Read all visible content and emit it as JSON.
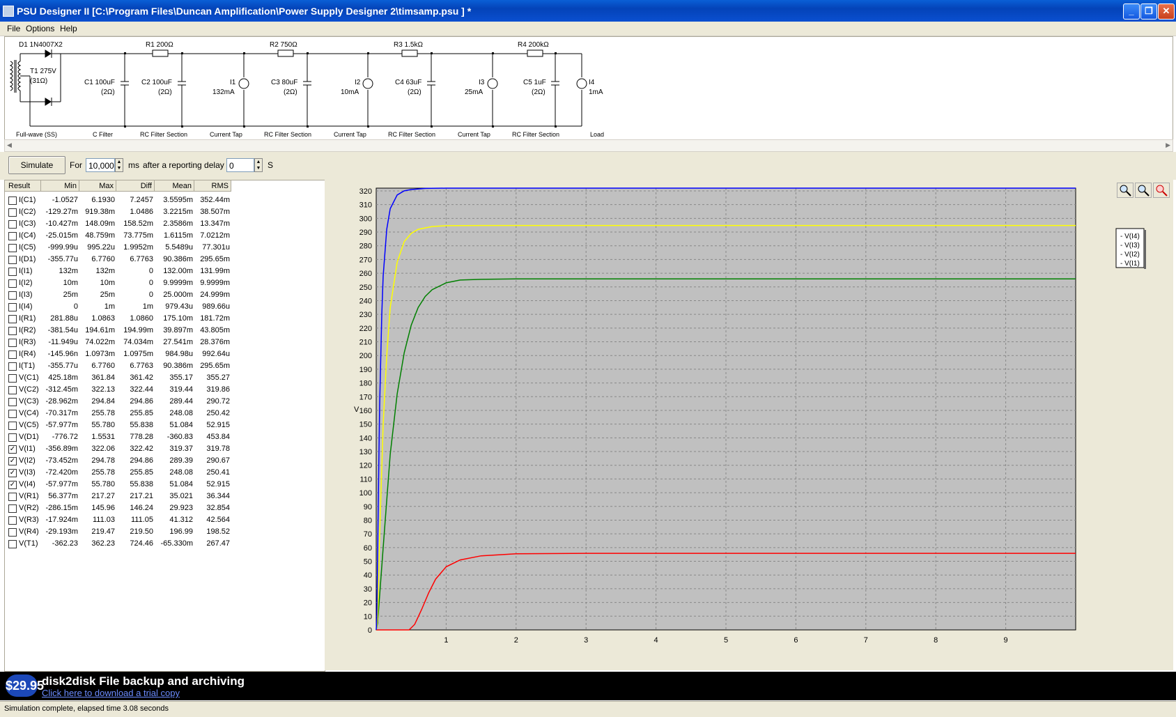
{
  "window": {
    "title": "PSU Designer II  [C:\\Program Files\\Duncan Amplification\\Power Supply Designer  2\\timsamp.psu ] *",
    "minimize": "_",
    "restore": "❐",
    "close": "✕"
  },
  "menu": {
    "file": "File",
    "options": "Options",
    "help": "Help"
  },
  "schematic": {
    "d1": "D1 1N4007X2",
    "t1_line1": "T1 275V",
    "t1_line2": "(31Ω)",
    "r1": "R1 200Ω",
    "r2": "R2 750Ω",
    "r3": "R3 1.5kΩ",
    "r4": "R4 200kΩ",
    "c1_line1": "C1 100uF",
    "c1_line2": "(2Ω)",
    "c2_line1": "C2 100uF",
    "c2_line2": "(2Ω)",
    "i1_line1": "I1",
    "i1_line2": "132mA",
    "c3_line1": "C3 80uF",
    "c3_line2": "(2Ω)",
    "i2_line1": "I2",
    "i2_line2": "10mA",
    "c4_line1": "C4 63uF",
    "c4_line2": "(2Ω)",
    "i3_line1": "I3",
    "i3_line2": "25mA",
    "c5_line1": "C5 1uF",
    "c5_line2": "(2Ω)",
    "i4_line1": "I4",
    "i4_line2": "1mA",
    "sections": [
      "Full-wave (SS)",
      "C Filter",
      "RC Filter Section",
      "Current Tap",
      "RC Filter Section",
      "Current Tap",
      "RC Filter Section",
      "Current Tap",
      "RC Filter Section",
      "Load"
    ]
  },
  "toolbar": {
    "simulate": "Simulate",
    "for": "For",
    "duration": "10,000",
    "ms": "ms",
    "delay_label": "after a reporting delay of",
    "delay": "0",
    "s": "S"
  },
  "table": {
    "headers": [
      "Result",
      "Min",
      "Max",
      "Diff",
      "Mean",
      "RMS"
    ],
    "rows": [
      {
        "checked": false,
        "name": "I(C1)",
        "min": "-1.0527",
        "max": "6.1930",
        "diff": "7.2457",
        "mean": "3.5595m",
        "rms": "352.44m"
      },
      {
        "checked": false,
        "name": "I(C2)",
        "min": "-129.27m",
        "max": "919.38m",
        "diff": "1.0486",
        "mean": "3.2215m",
        "rms": "38.507m"
      },
      {
        "checked": false,
        "name": "I(C3)",
        "min": "-10.427m",
        "max": "148.09m",
        "diff": "158.52m",
        "mean": "2.3586m",
        "rms": "13.347m"
      },
      {
        "checked": false,
        "name": "I(C4)",
        "min": "-25.015m",
        "max": "48.759m",
        "diff": "73.775m",
        "mean": "1.6115m",
        "rms": "7.0212m"
      },
      {
        "checked": false,
        "name": "I(C5)",
        "min": "-999.99u",
        "max": "995.22u",
        "diff": "1.9952m",
        "mean": "5.5489u",
        "rms": "77.301u"
      },
      {
        "checked": false,
        "name": "I(D1)",
        "min": "-355.77u",
        "max": "6.7760",
        "diff": "6.7763",
        "mean": "90.386m",
        "rms": "295.65m"
      },
      {
        "checked": false,
        "name": "I(I1)",
        "min": "132m",
        "max": "132m",
        "diff": "0",
        "mean": "132.00m",
        "rms": "131.99m"
      },
      {
        "checked": false,
        "name": "I(I2)",
        "min": "10m",
        "max": "10m",
        "diff": "0",
        "mean": "9.9999m",
        "rms": "9.9999m"
      },
      {
        "checked": false,
        "name": "I(I3)",
        "min": "25m",
        "max": "25m",
        "diff": "0",
        "mean": "25.000m",
        "rms": "24.999m"
      },
      {
        "checked": false,
        "name": "I(I4)",
        "min": "0",
        "max": "1m",
        "diff": "1m",
        "mean": "979.43u",
        "rms": "989.66u"
      },
      {
        "checked": false,
        "name": "I(R1)",
        "min": "281.88u",
        "max": "1.0863",
        "diff": "1.0860",
        "mean": "175.10m",
        "rms": "181.72m"
      },
      {
        "checked": false,
        "name": "I(R2)",
        "min": "-381.54u",
        "max": "194.61m",
        "diff": "194.99m",
        "mean": "39.897m",
        "rms": "43.805m"
      },
      {
        "checked": false,
        "name": "I(R3)",
        "min": "-11.949u",
        "max": "74.022m",
        "diff": "74.034m",
        "mean": "27.541m",
        "rms": "28.376m"
      },
      {
        "checked": false,
        "name": "I(R4)",
        "min": "-145.96n",
        "max": "1.0973m",
        "diff": "1.0975m",
        "mean": "984.98u",
        "rms": "992.64u"
      },
      {
        "checked": false,
        "name": "I(T1)",
        "min": "-355.77u",
        "max": "6.7760",
        "diff": "6.7763",
        "mean": "90.386m",
        "rms": "295.65m"
      },
      {
        "checked": false,
        "name": "V(C1)",
        "min": "425.18m",
        "max": "361.84",
        "diff": "361.42",
        "mean": "355.17",
        "rms": "355.27"
      },
      {
        "checked": false,
        "name": "V(C2)",
        "min": "-312.45m",
        "max": "322.13",
        "diff": "322.44",
        "mean": "319.44",
        "rms": "319.86"
      },
      {
        "checked": false,
        "name": "V(C3)",
        "min": "-28.962m",
        "max": "294.84",
        "diff": "294.86",
        "mean": "289.44",
        "rms": "290.72"
      },
      {
        "checked": false,
        "name": "V(C4)",
        "min": "-70.317m",
        "max": "255.78",
        "diff": "255.85",
        "mean": "248.08",
        "rms": "250.42"
      },
      {
        "checked": false,
        "name": "V(C5)",
        "min": "-57.977m",
        "max": "55.780",
        "diff": "55.838",
        "mean": "51.084",
        "rms": "52.915"
      },
      {
        "checked": false,
        "name": "V(D1)",
        "min": "-776.72",
        "max": "1.5531",
        "diff": "778.28",
        "mean": "-360.83",
        "rms": "453.84"
      },
      {
        "checked": true,
        "name": "V(I1)",
        "min": "-356.89m",
        "max": "322.06",
        "diff": "322.42",
        "mean": "319.37",
        "rms": "319.78"
      },
      {
        "checked": true,
        "name": "V(I2)",
        "min": "-73.452m",
        "max": "294.78",
        "diff": "294.86",
        "mean": "289.39",
        "rms": "290.67"
      },
      {
        "checked": true,
        "name": "V(I3)",
        "min": "-72.420m",
        "max": "255.78",
        "diff": "255.85",
        "mean": "248.08",
        "rms": "250.41"
      },
      {
        "checked": true,
        "name": "V(I4)",
        "min": "-57.977m",
        "max": "55.780",
        "diff": "55.838",
        "mean": "51.084",
        "rms": "52.915"
      },
      {
        "checked": false,
        "name": "V(R1)",
        "min": "56.377m",
        "max": "217.27",
        "diff": "217.21",
        "mean": "35.021",
        "rms": "36.344"
      },
      {
        "checked": false,
        "name": "V(R2)",
        "min": "-286.15m",
        "max": "145.96",
        "diff": "146.24",
        "mean": "29.923",
        "rms": "32.854"
      },
      {
        "checked": false,
        "name": "V(R3)",
        "min": "-17.924m",
        "max": "111.03",
        "diff": "111.05",
        "mean": "41.312",
        "rms": "42.564"
      },
      {
        "checked": false,
        "name": "V(R4)",
        "min": "-29.193m",
        "max": "219.47",
        "diff": "219.50",
        "mean": "196.99",
        "rms": "198.52"
      },
      {
        "checked": false,
        "name": "V(T1)",
        "min": "-362.23",
        "max": "362.23",
        "diff": "724.46",
        "mean": "-65.330m",
        "rms": "267.47"
      }
    ]
  },
  "chart_data": {
    "type": "line",
    "ylabel": "V",
    "xlabel": "",
    "xlim": [
      0,
      10
    ],
    "ylim": [
      0,
      322
    ],
    "xticks": [
      "1",
      "2",
      "3",
      "4",
      "5",
      "6",
      "7",
      "8",
      "9"
    ],
    "yticks": [
      "0",
      "10",
      "20",
      "30",
      "40",
      "50",
      "60",
      "70",
      "80",
      "90",
      "100",
      "110",
      "120",
      "130",
      "140",
      "150",
      "160",
      "170",
      "180",
      "190",
      "200",
      "210",
      "220",
      "230",
      "240",
      "250",
      "260",
      "270",
      "280",
      "290",
      "300",
      "310",
      "320"
    ],
    "grid": true,
    "legend_position": "right",
    "background": "#c0c0c0",
    "series": [
      {
        "name": "V(I4)",
        "color": "#ff0000",
        "x": [
          0,
          0.4,
          0.47,
          0.55,
          0.65,
          0.75,
          0.85,
          1.0,
          1.2,
          1.5,
          2,
          3,
          5,
          10
        ],
        "y": [
          0,
          0,
          0,
          4,
          15,
          27,
          37,
          46,
          51,
          54,
          55.5,
          55.8,
          55.8,
          55.8
        ]
      },
      {
        "name": "V(I3)",
        "color": "#008000",
        "x": [
          0,
          0.02,
          0.1,
          0.2,
          0.3,
          0.4,
          0.5,
          0.6,
          0.7,
          0.8,
          1.0,
          1.2,
          1.5,
          2,
          3,
          5,
          10
        ],
        "y": [
          0,
          5,
          60,
          128,
          172,
          202,
          222,
          235,
          243,
          248,
          253,
          255,
          255.5,
          255.8,
          255.8,
          255.8,
          255.8
        ]
      },
      {
        "name": "V(I2)",
        "color": "#ffff00",
        "x": [
          0,
          0.02,
          0.05,
          0.1,
          0.15,
          0.2,
          0.3,
          0.4,
          0.5,
          0.6,
          0.8,
          1.0,
          1.5,
          2,
          5,
          10
        ],
        "y": [
          0,
          8,
          70,
          150,
          200,
          235,
          268,
          283,
          289,
          292,
          294,
          294.6,
          294.8,
          294.8,
          294.8,
          294.8
        ]
      },
      {
        "name": "V(I1)",
        "color": "#0000ff",
        "x": [
          0,
          0.01,
          0.03,
          0.05,
          0.08,
          0.1,
          0.15,
          0.2,
          0.3,
          0.4,
          0.5,
          0.7,
          1.0,
          1.5,
          2,
          5,
          10
        ],
        "y": [
          0,
          10,
          95,
          165,
          230,
          258,
          292,
          307,
          317,
          320,
          321,
          321.8,
          322,
          322,
          322,
          322,
          322
        ]
      }
    ],
    "legend_order": [
      "V(I4)",
      "V(I3)",
      "V(I2)",
      "V(I1)"
    ]
  },
  "ad": {
    "price": "$29.95",
    "title": "disk2disk File backup and archiving",
    "link": "Click here to download a trial copy"
  },
  "status": "Simulation complete, elapsed time 3.08 seconds"
}
